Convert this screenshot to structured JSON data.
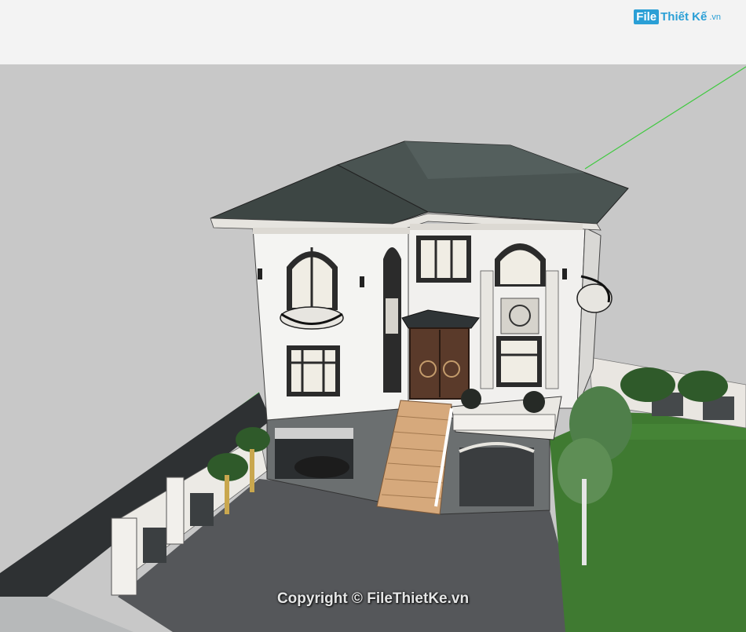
{
  "watermark": {
    "logo_file": "File",
    "logo_rest": "Thiết Kế",
    "logo_tld": ".vn",
    "copyright": "Copyright © FileThietKe.vn"
  },
  "scene": {
    "subject": "3D model",
    "colors": {
      "sky": "#f3f3f3",
      "ground_plane": "#c8c8c8",
      "axis_line": "#3ec93e",
      "roof": "#3d4644",
      "wall": "#f4f4f2",
      "trim": "#d8d5cf",
      "window_frame": "#2b2b2b",
      "glass": "#f0ede4",
      "door": "#5a3a2a",
      "paving": "#55575a",
      "lawn": "#3f7a31",
      "stairs": "#d6a97c",
      "plinth": "#6b6f70",
      "fence": "#eceae5"
    }
  }
}
